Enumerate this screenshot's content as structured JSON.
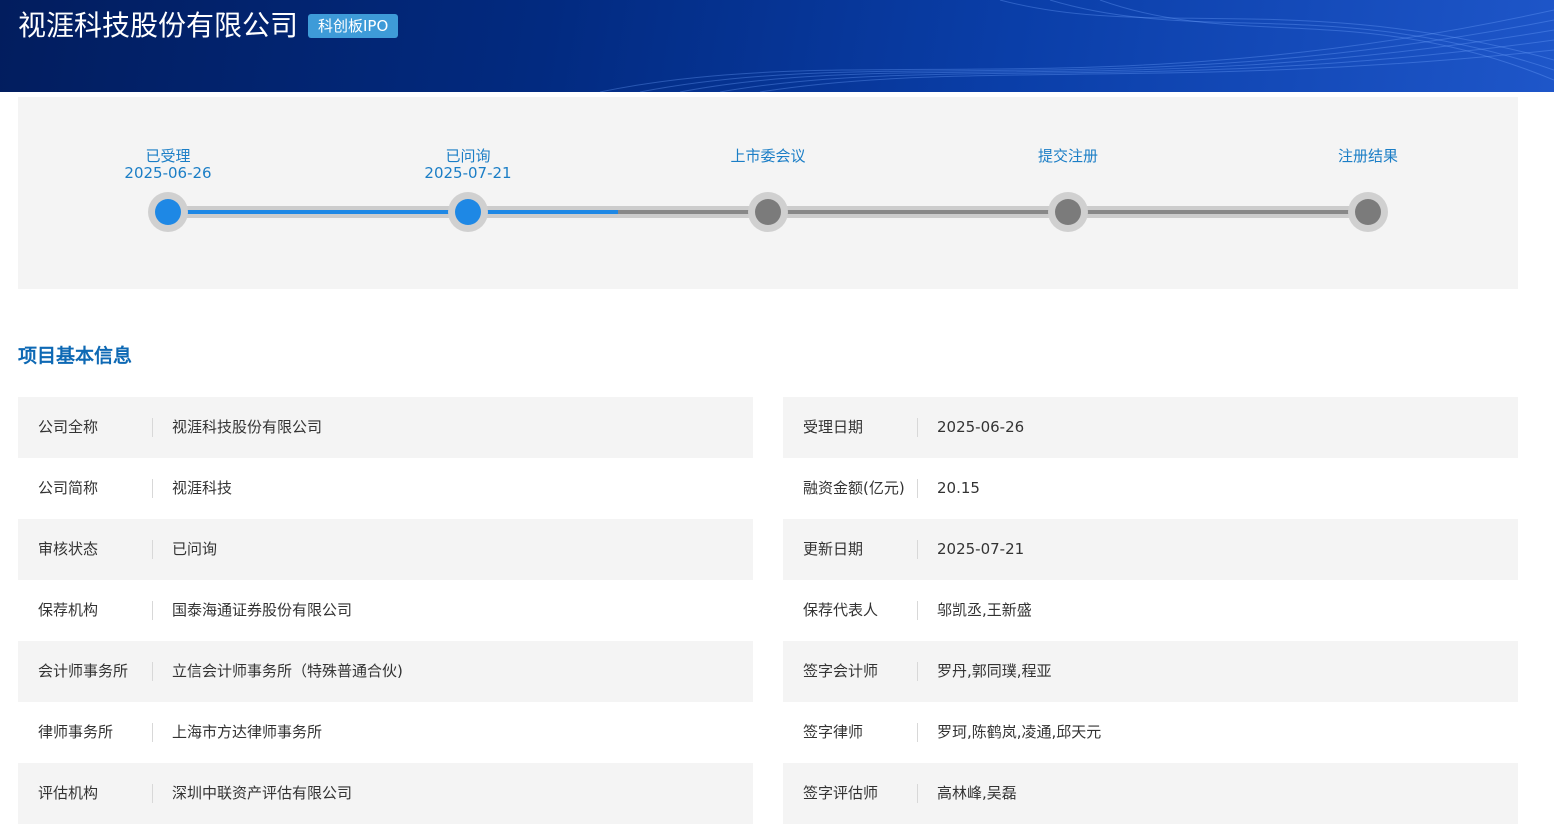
{
  "header": {
    "company_name": "视涯科技股份有限公司",
    "board_badge": "科创板IPO",
    "brand_color": "#022a80",
    "badge_color": "#3e9bd8"
  },
  "progress": {
    "active_color": "#1e88e5",
    "inactive_color": "#7b7b7b",
    "completed_fraction": 0.375,
    "steps": [
      {
        "label": "已受理",
        "date": "2025-06-26",
        "state": "done"
      },
      {
        "label": "已问询",
        "date": "2025-07-21",
        "state": "done"
      },
      {
        "label": "上市委会议",
        "date": "",
        "state": "pending"
      },
      {
        "label": "提交注册",
        "date": "",
        "state": "pending"
      },
      {
        "label": "注册结果",
        "date": "",
        "state": "pending"
      }
    ]
  },
  "basic_info": {
    "title": "项目基本信息",
    "left": [
      {
        "label": "公司全称",
        "value": "视涯科技股份有限公司"
      },
      {
        "label": "公司简称",
        "value": "视涯科技"
      },
      {
        "label": "审核状态",
        "value": "已问询"
      },
      {
        "label": "保荐机构",
        "value": "国泰海通证券股份有限公司"
      },
      {
        "label": "会计师事务所",
        "value": "立信会计师事务所（特殊普通合伙)"
      },
      {
        "label": "律师事务所",
        "value": "上海市方达律师事务所"
      },
      {
        "label": "评估机构",
        "value": "深圳中联资产评估有限公司"
      }
    ],
    "right": [
      {
        "label": "受理日期",
        "value": "2025-06-26"
      },
      {
        "label": "融资金额(亿元)",
        "value": "20.15"
      },
      {
        "label": "更新日期",
        "value": "2025-07-21"
      },
      {
        "label": "保荐代表人",
        "value": "邬凯丞,王新盛"
      },
      {
        "label": "签字会计师",
        "value": "罗丹,郭同璞,程亚"
      },
      {
        "label": "签字律师",
        "value": "罗珂,陈鹤岚,凌通,邱天元"
      },
      {
        "label": "签字评估师",
        "value": "高林峰,吴磊"
      }
    ]
  }
}
